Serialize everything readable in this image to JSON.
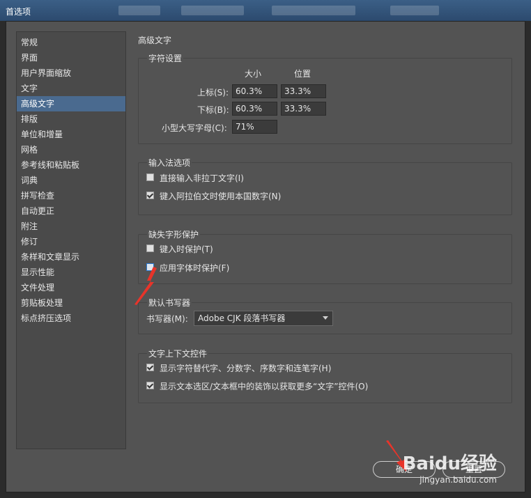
{
  "window": {
    "title": "首选项"
  },
  "sidebar": {
    "items": [
      {
        "label": "常规"
      },
      {
        "label": "界面"
      },
      {
        "label": "用户界面缩放"
      },
      {
        "label": "文字"
      },
      {
        "label": "高级文字",
        "selected": true
      },
      {
        "label": "排版"
      },
      {
        "label": "单位和增量"
      },
      {
        "label": "网格"
      },
      {
        "label": "参考线和粘贴板"
      },
      {
        "label": "词典"
      },
      {
        "label": "拼写检查"
      },
      {
        "label": "自动更正"
      },
      {
        "label": "附注"
      },
      {
        "label": "修订"
      },
      {
        "label": "条样和文章显示"
      },
      {
        "label": "显示性能"
      },
      {
        "label": "文件处理"
      },
      {
        "label": "剪贴板处理"
      },
      {
        "label": "标点挤压选项"
      }
    ]
  },
  "main": {
    "title": "高级文字",
    "char_settings": {
      "legend": "字符设置",
      "col_size": "大小",
      "col_position": "位置",
      "superscript_label": "上标(S):",
      "superscript_size": "60.3%",
      "superscript_position": "33.3%",
      "subscript_label": "下标(B):",
      "subscript_size": "60.3%",
      "subscript_position": "33.3%",
      "smallcaps_label": "小型大写字母(C):",
      "smallcaps_value": "71%"
    },
    "ime": {
      "legend": "输入法选项",
      "option1": "直接输入非拉丁文字(I)",
      "option1_checked": false,
      "option2": "键入阿拉伯文时使用本国数字(N)",
      "option2_checked": true
    },
    "missing_glyph": {
      "legend": "缺失字形保护",
      "option1": "键入时保护(T)",
      "option1_checked": false,
      "option2": "应用字体时保护(F)",
      "option2_checked": false
    },
    "composer": {
      "legend": "默认书写器",
      "label": "书写器(M):",
      "value": "Adobe CJK 段落书写器"
    },
    "context_controls": {
      "legend": "文字上下文控件",
      "option1": "显示字符替代字、分数字、序数字和连笔字(H)",
      "option1_checked": true,
      "option2": "显示文本选区/文本框中的装饰以获取更多“文字”控件(O)",
      "option2_checked": true
    }
  },
  "buttons": {
    "ok": "确定",
    "reset": "重置"
  },
  "watermark": {
    "brand": "Baidu经验",
    "url": "jingyan.baidu.com"
  },
  "colors": {
    "selected": "#4a6a8f",
    "annotation_arrow": "#e8342a"
  }
}
